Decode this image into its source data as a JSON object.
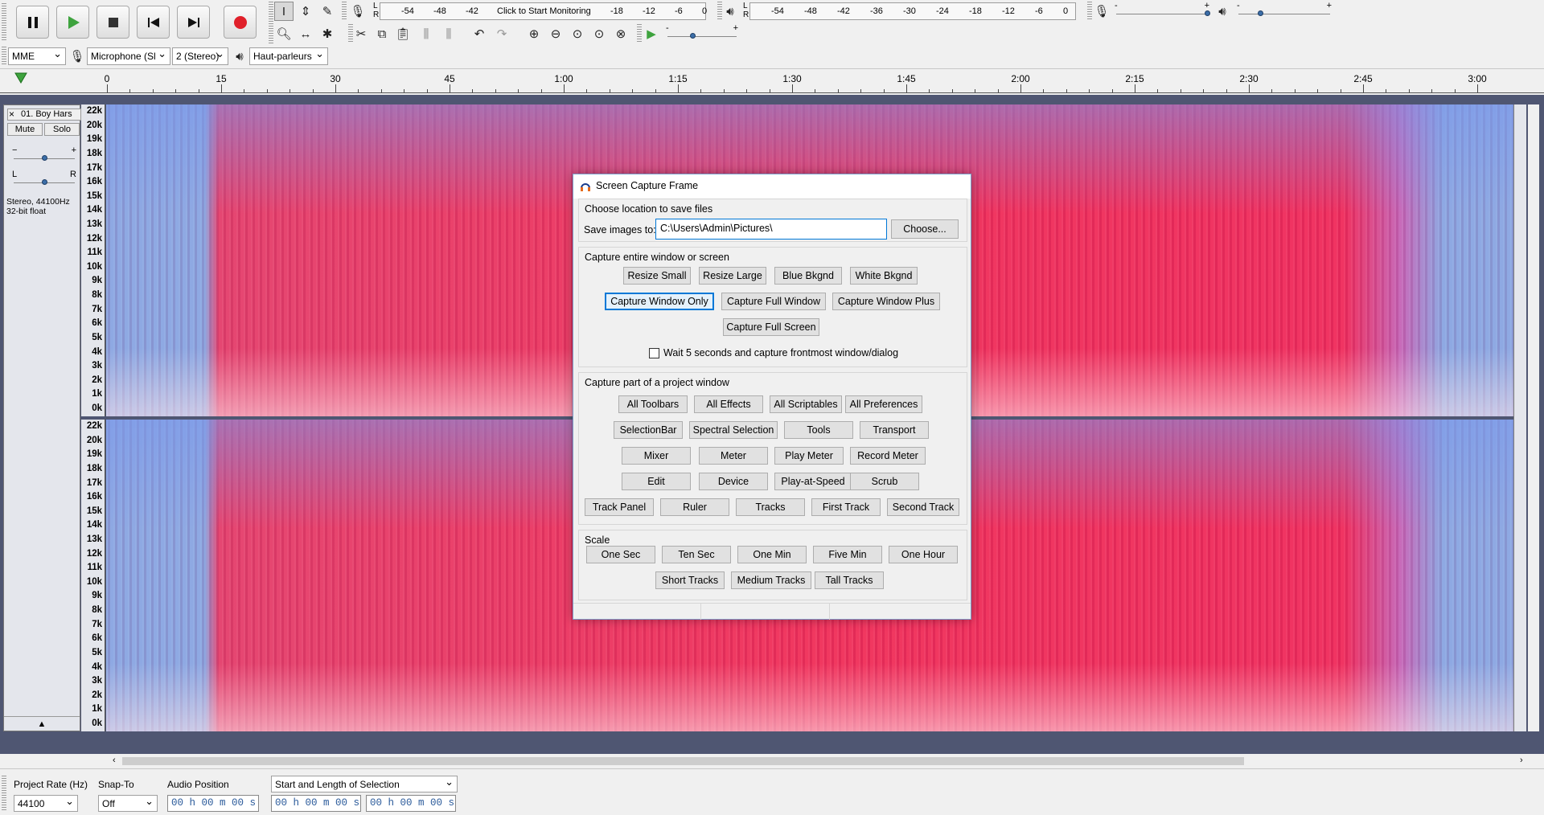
{
  "transport": {
    "buttons": [
      {
        "name": "pause-button",
        "icon": "pause-icon"
      },
      {
        "name": "play-button",
        "icon": "play-icon"
      },
      {
        "name": "stop-button",
        "icon": "stop-icon"
      },
      {
        "name": "skip-start-button",
        "icon": "skip-start-icon"
      },
      {
        "name": "skip-end-button",
        "icon": "skip-end-icon"
      },
      {
        "name": "record-button",
        "icon": "record-icon"
      }
    ]
  },
  "record_meter": {
    "channel_l": "L",
    "channel_r": "R",
    "ticks": [
      "-54",
      "-48",
      "-42",
      "Click to Start Monitoring",
      "-18",
      "-12",
      "-6",
      "0"
    ]
  },
  "play_meter": {
    "channel_l": "L",
    "channel_r": "R",
    "ticks": [
      "-54",
      "-48",
      "-42",
      "-36",
      "-30",
      "-24",
      "-18",
      "-12",
      "-6",
      "0"
    ]
  },
  "mixer": {
    "record_volume": 1.0,
    "playback_volume": 0.2,
    "minus": "-",
    "plus": "+"
  },
  "device": {
    "host": "MME",
    "recording_device": "Microphone (Sl",
    "channels": "2 (Stereo)",
    "playback_device": "Haut-parleurs"
  },
  "ruler": {
    "labels": [
      "0",
      "15",
      "30",
      "45",
      "1:00",
      "1:15",
      "1:30",
      "1:45",
      "2:00",
      "2:15",
      "2:30",
      "2:45",
      "3:00"
    ]
  },
  "track": {
    "name": "01. Boy Hars",
    "close": "×",
    "mute": "Mute",
    "solo": "Solo",
    "gain_minus": "−",
    "gain_plus": "+",
    "pan_left": "L",
    "pan_right": "R",
    "info_line1": "Stereo, 44100Hz",
    "info_line2": "32-bit float",
    "collapse": "▲"
  },
  "freq_scale": [
    "22k",
    "20k",
    "19k",
    "18k",
    "17k",
    "16k",
    "15k",
    "14k",
    "13k",
    "12k",
    "11k",
    "10k",
    "9k",
    "8k",
    "7k",
    "6k",
    "5k",
    "4k",
    "3k",
    "2k",
    "1k",
    "0k"
  ],
  "selection_bar": {
    "project_rate_label": "Project Rate (Hz)",
    "project_rate_value": "44100",
    "snap_to_label": "Snap-To",
    "snap_to_value": "Off",
    "audio_position_label": "Audio Position",
    "audio_position_value": "00 h 00 m 00 s",
    "selection_mode": "Start and Length of Selection",
    "selection_start": "00 h 00 m 00 s",
    "selection_length": "00 h 00 m 00 s"
  },
  "dialog": {
    "title": "Screen Capture Frame",
    "location_group": "Choose location to save files",
    "save_label": "Save images to:",
    "save_path": "C:\\Users\\Admin\\Pictures\\",
    "choose_button": "Choose...",
    "entire_group": "Capture entire window or screen",
    "resize_small": "Resize Small",
    "resize_large": "Resize Large",
    "blue_bkgnd": "Blue Bkgnd",
    "white_bkgnd": "White Bkgnd",
    "capture_window_only": "Capture Window Only",
    "capture_full_window": "Capture Full Window",
    "capture_window_plus": "Capture Window Plus",
    "capture_full_screen": "Capture Full Screen",
    "wait_checkbox": "Wait 5 seconds and capture frontmost window/dialog",
    "part_group": "Capture part of a project window",
    "part_buttons": [
      [
        "All Toolbars",
        "All Effects",
        "All Scriptables",
        "All Preferences"
      ],
      [
        "SelectionBar",
        "Spectral Selection",
        "Tools",
        "Transport"
      ],
      [
        "Mixer",
        "Meter",
        "Play Meter",
        "Record Meter"
      ],
      [
        "Edit",
        "Device",
        "Play-at-Speed",
        "Scrub"
      ],
      [
        "Track Panel",
        "Ruler",
        "Tracks",
        "First Track",
        "Second Track"
      ]
    ],
    "scale_group": "Scale",
    "scale_buttons": [
      "One Sec",
      "Ten Sec",
      "One Min",
      "Five Min",
      "One Hour"
    ],
    "track_size_buttons": [
      "Short Tracks",
      "Medium Tracks",
      "Tall Tracks"
    ]
  }
}
